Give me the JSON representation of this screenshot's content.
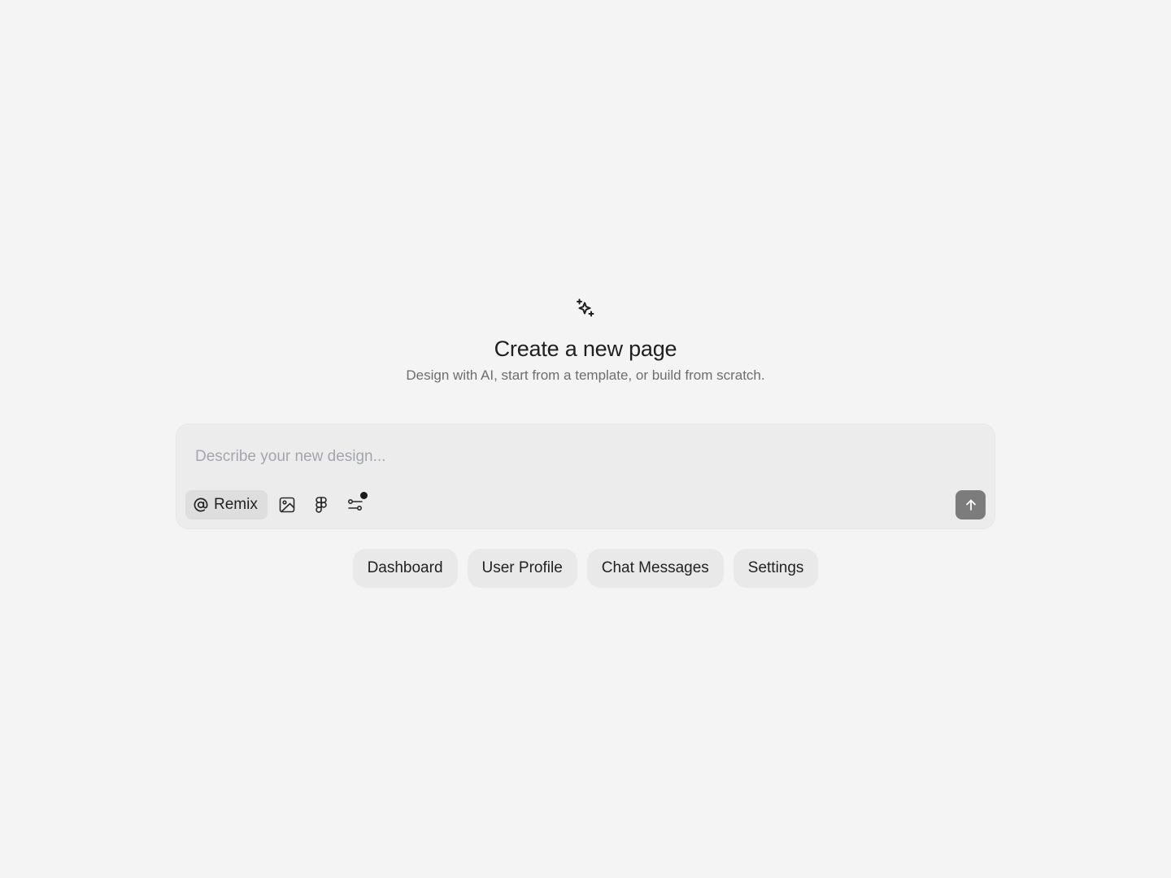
{
  "hero": {
    "icon": "sparkles-icon",
    "title": "Create a new page",
    "subtitle": "Design with AI, start from a template, or build from scratch."
  },
  "composer": {
    "placeholder": "Describe your new design...",
    "value": "",
    "remix_label": "Remix",
    "tools": [
      "at-icon",
      "image-icon",
      "figma-icon",
      "connect-icon"
    ],
    "send_icon": "arrow-up-icon",
    "send_enabled": false
  },
  "suggestions": [
    {
      "label": "Dashboard"
    },
    {
      "label": "User Profile"
    },
    {
      "label": "Chat Messages"
    },
    {
      "label": "Settings"
    }
  ],
  "colors": {
    "background": "#f4f4f4",
    "composer_bg": "#ececec",
    "send_button_bg": "#7c7c7c",
    "chip_bg": "#e9e9e9",
    "notification_dot": "#1a1a1a"
  }
}
